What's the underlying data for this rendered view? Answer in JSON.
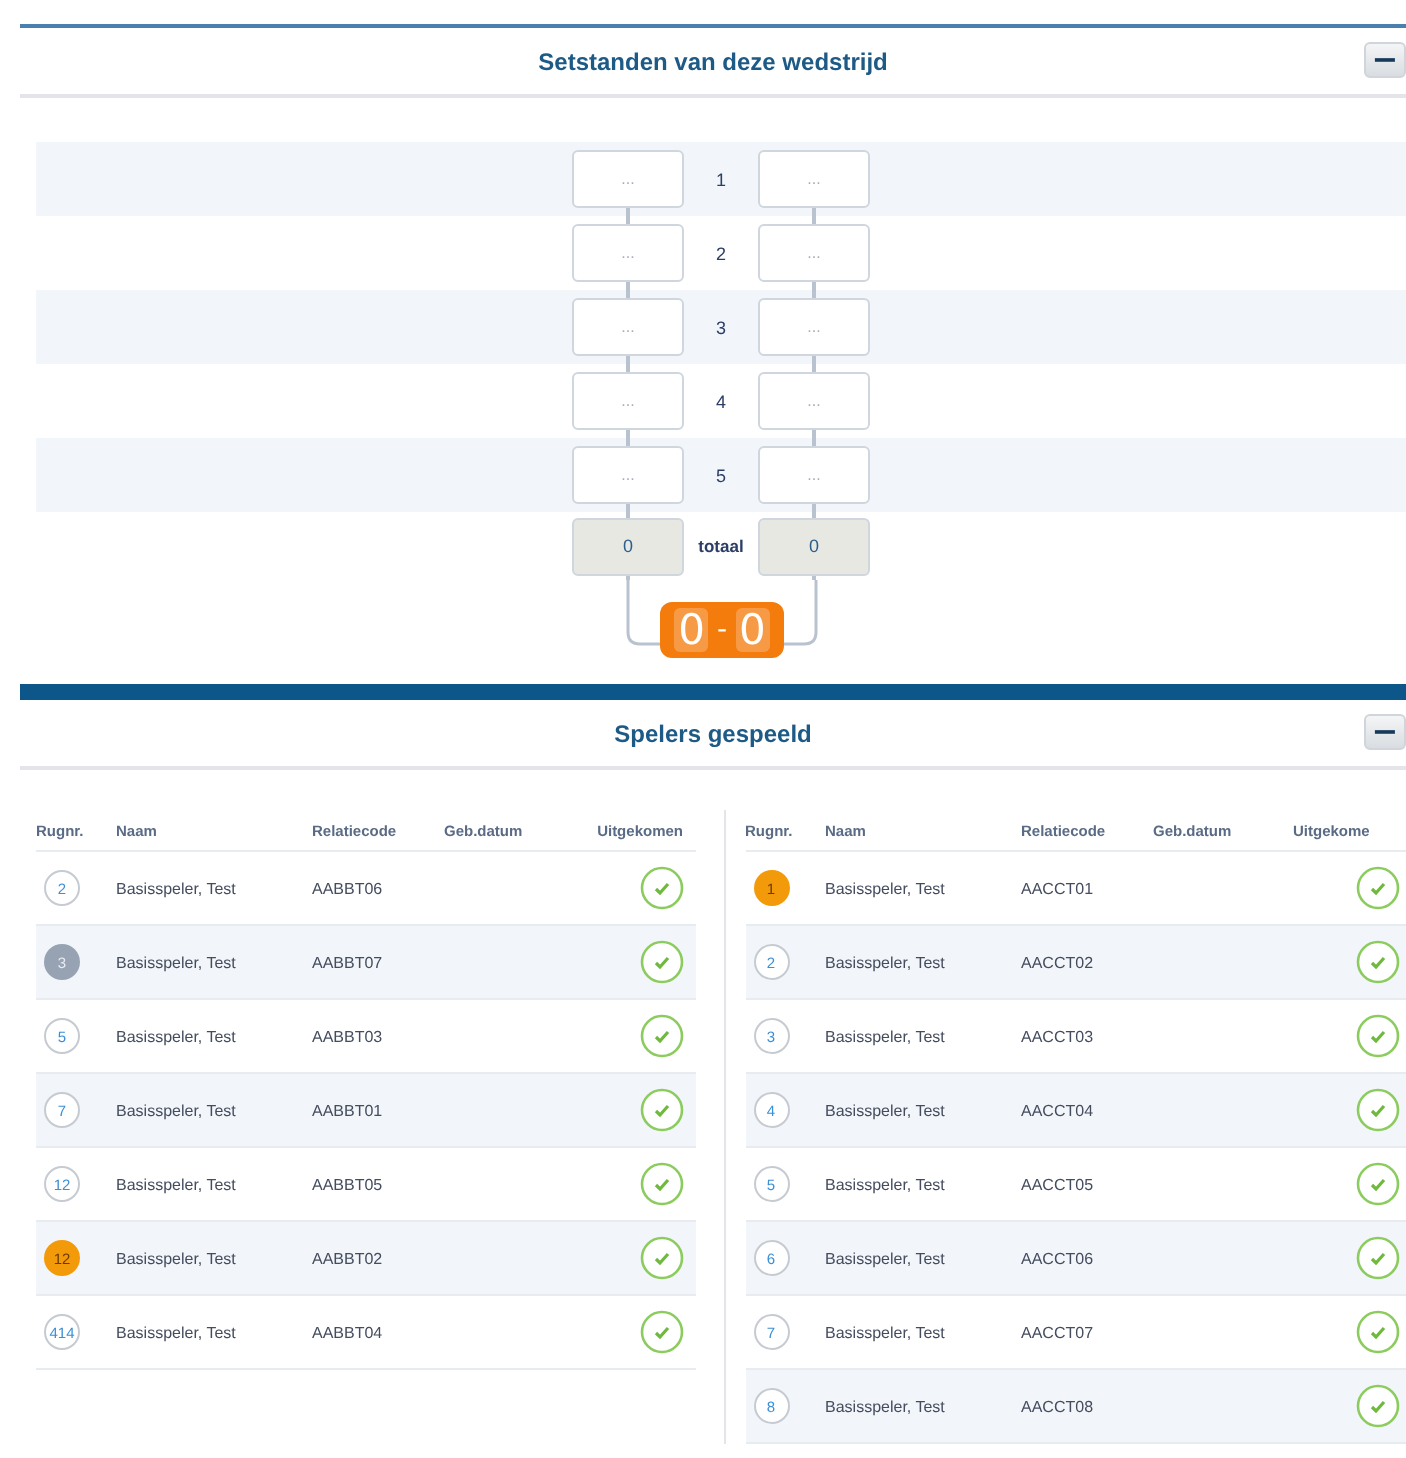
{
  "sets_panel": {
    "title": "Setstanden van deze wedstrijd",
    "collapse_symbol": "−",
    "sets": [
      {
        "label": "1",
        "home_placeholder": "...",
        "away_placeholder": "..."
      },
      {
        "label": "2",
        "home_placeholder": "...",
        "away_placeholder": "..."
      },
      {
        "label": "3",
        "home_placeholder": "...",
        "away_placeholder": "..."
      },
      {
        "label": "4",
        "home_placeholder": "...",
        "away_placeholder": "..."
      },
      {
        "label": "5",
        "home_placeholder": "...",
        "away_placeholder": "..."
      }
    ],
    "total": {
      "label": "totaal",
      "home": "0",
      "away": "0"
    },
    "score": {
      "home": "0",
      "separator": "-",
      "away": "0"
    }
  },
  "players_panel": {
    "title": "Spelers gespeeld",
    "collapse_symbol": "−",
    "teams": [
      {
        "columns": [
          "Rugnr.",
          "Naam",
          "Relatiecode",
          "Geb.datum",
          "Uitgekomen"
        ],
        "rows": [
          {
            "number": "2",
            "kind": "outline",
            "name": "Basisspeler, Test",
            "code": "AABBT06",
            "played": true
          },
          {
            "number": "3",
            "kind": "grey",
            "name": "Basisspeler, Test",
            "code": "AABBT07",
            "played": true
          },
          {
            "number": "5",
            "kind": "outline",
            "name": "Basisspeler, Test",
            "code": "AABBT03",
            "played": true
          },
          {
            "number": "7",
            "kind": "outline",
            "name": "Basisspeler, Test",
            "code": "AABBT01",
            "played": true
          },
          {
            "number": "12",
            "kind": "outline",
            "name": "Basisspeler, Test",
            "code": "AABBT05",
            "played": true
          },
          {
            "number": "12",
            "kind": "orange",
            "name": "Basisspeler, Test",
            "code": "AABBT02",
            "played": true
          },
          {
            "number": "414",
            "kind": "outline",
            "name": "Basisspeler, Test",
            "code": "AABBT04",
            "played": true
          }
        ]
      },
      {
        "columns": [
          "Rugnr.",
          "Naam",
          "Relatiecode",
          "Geb.datum",
          "Uitgekome"
        ],
        "rows": [
          {
            "number": "1",
            "kind": "orange",
            "name": "Basisspeler, Test",
            "code": "AACCT01",
            "played": true
          },
          {
            "number": "2",
            "kind": "outline",
            "name": "Basisspeler, Test",
            "code": "AACCT02",
            "played": true
          },
          {
            "number": "3",
            "kind": "outline",
            "name": "Basisspeler, Test",
            "code": "AACCT03",
            "played": true
          },
          {
            "number": "4",
            "kind": "outline",
            "name": "Basisspeler, Test",
            "code": "AACCT04",
            "played": true
          },
          {
            "number": "5",
            "kind": "outline",
            "name": "Basisspeler, Test",
            "code": "AACCT05",
            "played": true
          },
          {
            "number": "6",
            "kind": "outline",
            "name": "Basisspeler, Test",
            "code": "AACCT06",
            "played": true
          },
          {
            "number": "7",
            "kind": "outline",
            "name": "Basisspeler, Test",
            "code": "AACCT07",
            "played": true
          },
          {
            "number": "8",
            "kind": "outline",
            "name": "Basisspeler, Test",
            "code": "AACCT08",
            "played": true
          }
        ]
      }
    ]
  }
}
